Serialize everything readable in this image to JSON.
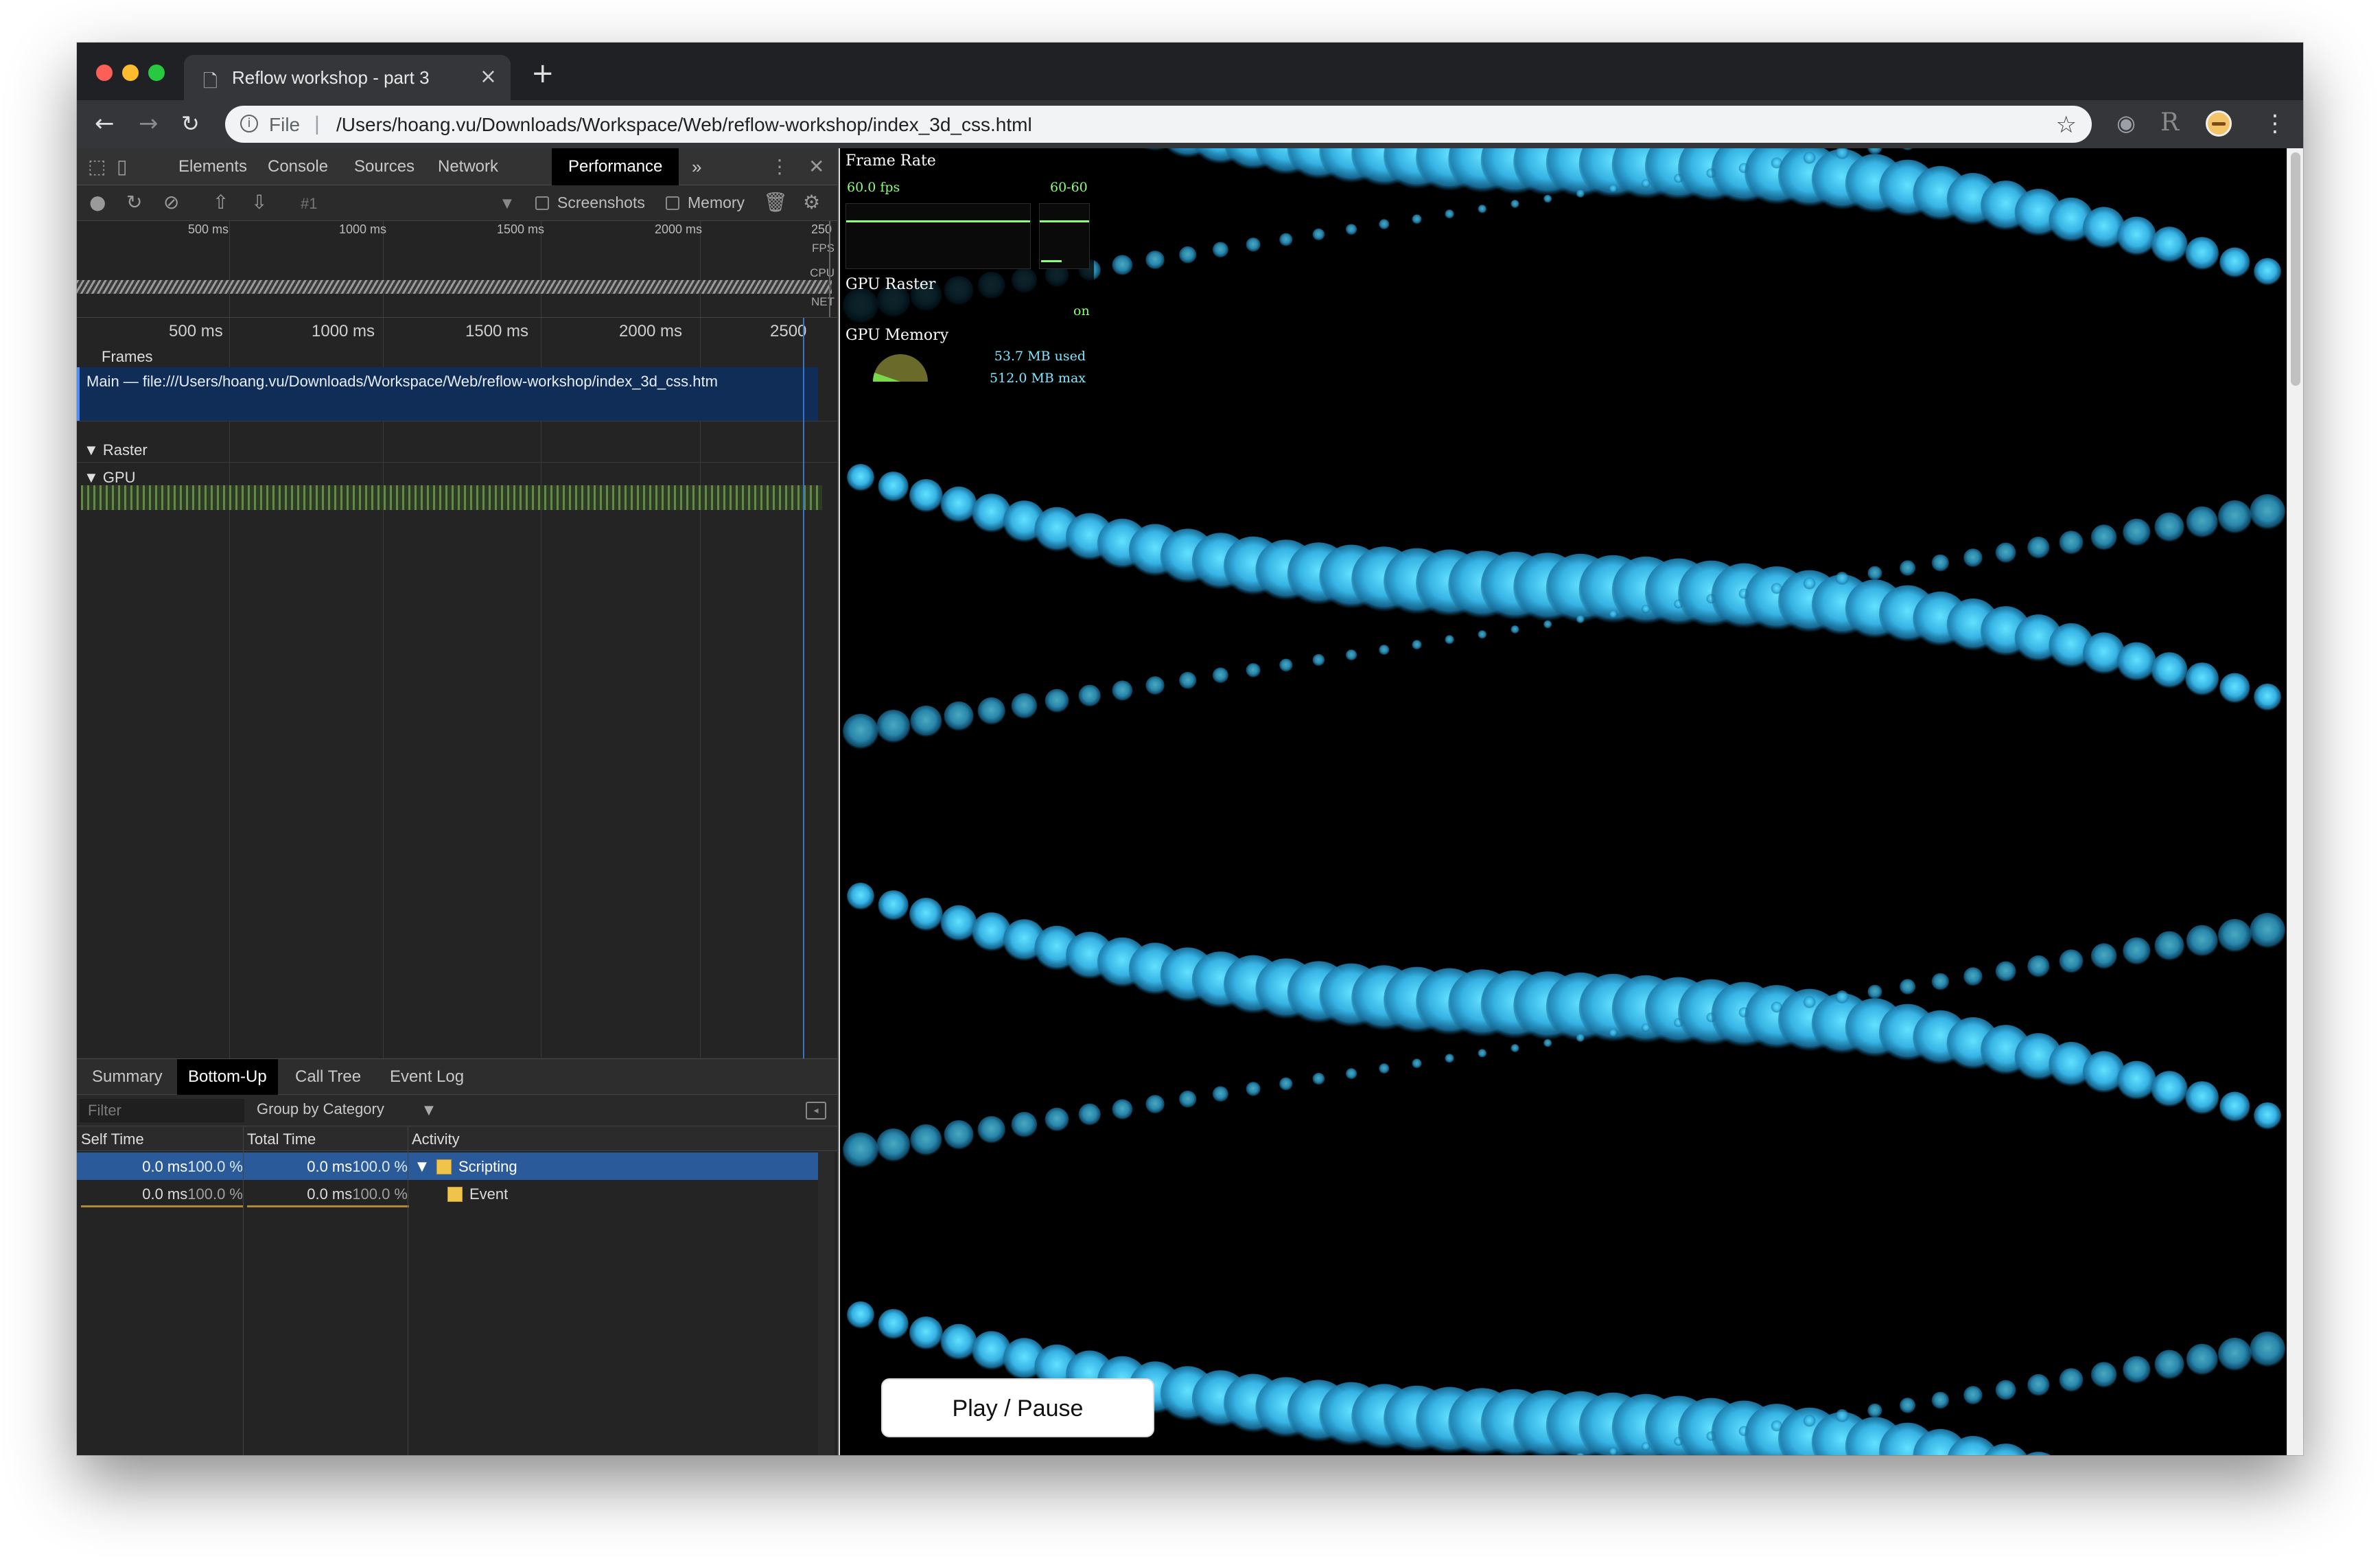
{
  "browser": {
    "tab_title": "Reflow workshop - part 3",
    "new_tab_icon": "plus-icon",
    "url_scheme_label": "File",
    "url_separator": "|",
    "url": "/Users/hoang.vu/Downloads/Workspace/Web/reflow-workshop/index_3d_css.html",
    "info_glyph": "i"
  },
  "devtools": {
    "tabs": [
      "Elements",
      "Console",
      "Sources",
      "Network",
      "Performance"
    ],
    "active_tab": "Performance",
    "more_tabs_glyph": "»",
    "toolbar": {
      "recording_label": "#1",
      "screenshots_label": "Screenshots",
      "memory_label": "Memory"
    },
    "overview": {
      "ticks": [
        "500 ms",
        "1000 ms",
        "1500 ms",
        "2000 ms",
        "250"
      ],
      "labels": [
        "FPS",
        "CPU",
        "NET"
      ]
    },
    "timeline": {
      "ticks": [
        "500 ms",
        "1000 ms",
        "1500 ms",
        "2000 ms",
        "2500"
      ],
      "frames_label": "Frames",
      "main_label": "Main — file:///Users/hoang.vu/Downloads/Workspace/Web/reflow-workshop/index_3d_css.htm",
      "raster_label": "Raster",
      "gpu_label": "GPU"
    },
    "bottom": {
      "tabs": [
        "Summary",
        "Bottom-Up",
        "Call Tree",
        "Event Log"
      ],
      "active_tab": "Bottom-Up",
      "filter_placeholder": "Filter",
      "group_by": "Group by Category",
      "columns": [
        "Self Time",
        "Total Time",
        "Activity"
      ],
      "rows": [
        {
          "self_time": "0.0 ms",
          "self_pct": "100.0 %",
          "total_time": "0.0 ms",
          "total_pct": "100.0 %",
          "activity": "Scripting",
          "expanded": true,
          "selected": true
        },
        {
          "self_time": "0.0 ms",
          "self_pct": "100.0 %",
          "total_time": "0.0 ms",
          "total_pct": "100.0 %",
          "activity": "Event",
          "expanded": false,
          "selected": false
        }
      ]
    }
  },
  "hud": {
    "frame_rate_title": "Frame Rate",
    "fps": "60.0 fps",
    "fps_range": "60-60",
    "gpu_raster_title": "GPU Raster",
    "gpu_raster_state": "on",
    "gpu_memory_title": "GPU Memory",
    "mem_used": "53.7 MB used",
    "mem_max": "512.0 MB max",
    "mem_used_fraction": 0.105
  },
  "page": {
    "play_pause_label": "Play / Pause",
    "background_color": "#000000",
    "ball_color": "#3fb8e8"
  },
  "colors": {
    "active_tab_bg": "#000000",
    "selected_row_bg": "#2a5a99",
    "scripting_swatch": "#f0c44a",
    "hud_green": "#8cff7a",
    "hud_cyan": "#7fe7ff"
  }
}
